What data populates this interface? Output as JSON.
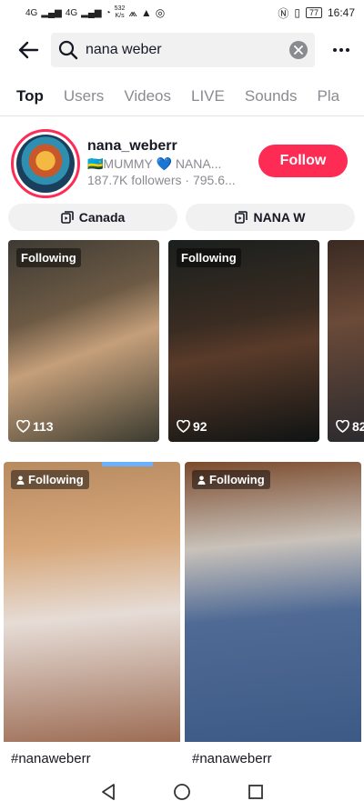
{
  "status_bar": {
    "sim1": "4G",
    "sim2": "4G",
    "net_speed": "532\nK/s",
    "battery": "77",
    "time": "16:47"
  },
  "search": {
    "query": "nana weber"
  },
  "tabs": [
    {
      "label": "Top",
      "active": true
    },
    {
      "label": "Users",
      "active": false
    },
    {
      "label": "Videos",
      "active": false
    },
    {
      "label": "LIVE",
      "active": false
    },
    {
      "label": "Sounds",
      "active": false
    },
    {
      "label": "Pla",
      "active": false
    }
  ],
  "account": {
    "username": "nana_weberr",
    "bio": "🇷🇼MUMMY 💙 NANA...",
    "stats": "187.7K followers · 795.6...",
    "follow_label": "Follow"
  },
  "chips": [
    {
      "label": "Canada"
    },
    {
      "label": "NANA W"
    }
  ],
  "videos": [
    {
      "badge": "Following",
      "likes": "113"
    },
    {
      "badge": "Following",
      "likes": "92"
    },
    {
      "badge": "",
      "likes": "82"
    }
  ],
  "posts": [
    {
      "badge": "Following",
      "tag": "#nanaweberr"
    },
    {
      "badge": "Following",
      "tag": "#nanaweberr"
    }
  ],
  "colors": {
    "accent": "#fe2c55",
    "text": "#161823",
    "muted": "#8a8b91",
    "chip_bg": "#f1f1f2"
  }
}
